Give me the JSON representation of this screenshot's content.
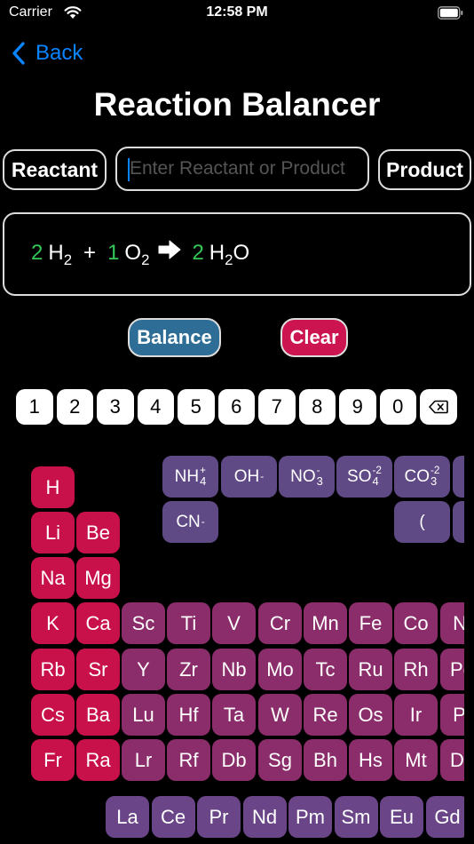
{
  "status_bar": {
    "carrier": "Carrier",
    "time": "12:58 PM"
  },
  "nav": {
    "back_label": "Back"
  },
  "title": "Reaction Balancer",
  "input_row": {
    "reactant_label": "Reactant",
    "product_label": "Product",
    "entry_value": "",
    "entry_placeholder": "Enter Reactant or Product"
  },
  "equation": {
    "reactants": [
      {
        "coef": "2",
        "symbol": "H",
        "sub": "2"
      },
      {
        "coef": "1",
        "symbol": "O",
        "sub": "2"
      }
    ],
    "plus": "+",
    "products": [
      {
        "coef": "2",
        "symbol": "H",
        "sub": "2",
        "tail": "O"
      }
    ]
  },
  "actions": {
    "balance_label": "Balance",
    "clear_label": "Clear"
  },
  "keypad": [
    "1",
    "2",
    "3",
    "4",
    "5",
    "6",
    "7",
    "8",
    "9",
    "0"
  ],
  "ions": [
    {
      "base": "NH",
      "sub": "4",
      "sup": "+"
    },
    {
      "base": "OH",
      "sub": "",
      "sup": "-"
    },
    {
      "base": "NO",
      "sub": "3",
      "sup": "-"
    },
    {
      "base": "SO",
      "sub": "4",
      "sup": "-2"
    },
    {
      "base": "CO",
      "sub": "3",
      "sup": "-2"
    },
    {
      "base": "CN",
      "sub": "",
      "sup": "-"
    },
    {
      "base": "(",
      "sub": "",
      "sup": ""
    }
  ],
  "elements": {
    "row1": [
      "H"
    ],
    "row2": [
      "Li",
      "Be"
    ],
    "row3": [
      "Na",
      "Mg"
    ],
    "row4": [
      "K",
      "Ca",
      "Sc",
      "Ti",
      "V",
      "Cr",
      "Mn",
      "Fe",
      "Co",
      "Ni"
    ],
    "row5": [
      "Rb",
      "Sr",
      "Y",
      "Zr",
      "Nb",
      "Mo",
      "Tc",
      "Ru",
      "Rh",
      "Pd"
    ],
    "row6": [
      "Cs",
      "Ba",
      "Lu",
      "Hf",
      "Ta",
      "W",
      "Re",
      "Os",
      "Ir",
      "Pt"
    ],
    "row7": [
      "Fr",
      "Ra",
      "Lr",
      "Rf",
      "Db",
      "Sg",
      "Bh",
      "Hs",
      "Mt",
      "Ds"
    ],
    "lanthanides": [
      "La",
      "Ce",
      "Pr",
      "Nd",
      "Pm",
      "Sm",
      "Eu",
      "Gd"
    ]
  },
  "colors": {
    "accent": "#0a84ff",
    "coefficient": "#34c759",
    "balance": "#2e6d96",
    "clear": "#cc1450",
    "alkali": "#c8114b",
    "transition": "#8a2d6a",
    "lanthanide": "#6a4688",
    "ion": "#5f4a86"
  }
}
